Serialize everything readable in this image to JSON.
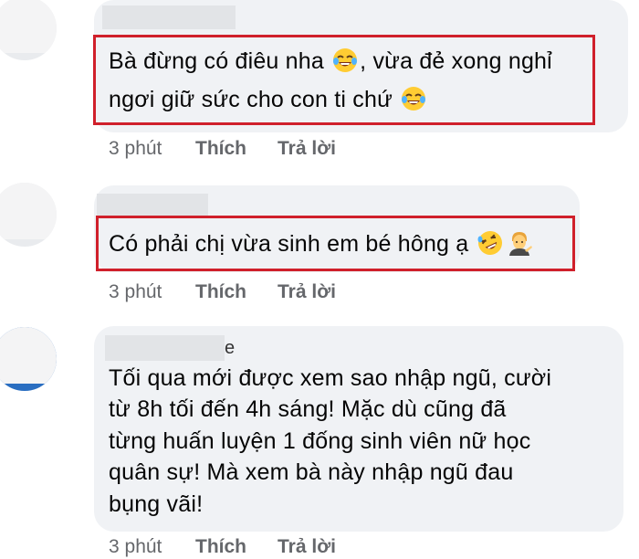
{
  "comments": [
    {
      "text": "Bà đừng có điêu nha 😂, vừa đẻ xong nghỉ ngơi giữ sức cho con ti chứ 😂",
      "line1_a": "Bà đừng có điêu nha",
      "line1_b": ", vừa đẻ xong nghỉ",
      "line2": "ngơi giữ sức cho con ti chứ",
      "emoji1": "tears-of-joy-emoji",
      "emoji2": "tears-of-joy-emoji",
      "time": "3 phút",
      "like": "Thích",
      "reply": "Trả lời"
    },
    {
      "text": "Có phải chị vừa sinh em bé hông ạ 🤣💁‍♂️",
      "line1": "Có phải chị vừa sinh em bé hông ạ",
      "emoji1": "rolling-on-floor-laughing-emoji",
      "emoji2": "person-tipping-hand-emoji",
      "time": "3 phút",
      "like": "Thích",
      "reply": "Trả lời"
    },
    {
      "name_tail": "e",
      "lines": [
        "Tối qua mới được xem sao nhập ngũ,  cười",
        "từ 8h tối đến 4h sáng!  Mặc dù cũng đã",
        "từng huấn luyện 1 đống sinh viên nữ học",
        "quân sự!  Mà xem bà này nhập ngũ đau",
        "bụng vãi!"
      ],
      "time": "3 phút",
      "like": "Thích",
      "reply": "Trả lời"
    }
  ],
  "colors": {
    "bubble": "#f0f2f5",
    "highlight": "#d0202b",
    "meta": "#65676b"
  }
}
